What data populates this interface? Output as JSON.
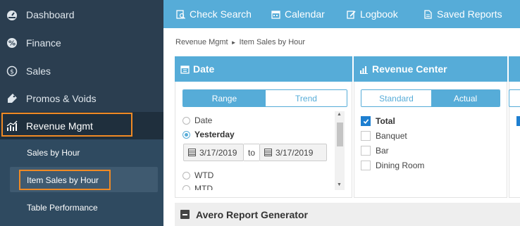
{
  "sidebar": {
    "items": [
      {
        "label": "Dashboard",
        "icon": "dashboard-icon"
      },
      {
        "label": "Finance",
        "icon": "percent-icon"
      },
      {
        "label": "Sales",
        "icon": "dollar-icon"
      },
      {
        "label": "Promos & Voids",
        "icon": "tag-icon"
      },
      {
        "label": "Revenue Mgmt",
        "icon": "chart-icon"
      }
    ],
    "subitems": [
      "Sales by Hour",
      "Item Sales by Hour",
      "Table Performance"
    ]
  },
  "toolbar": {
    "links": [
      "Check Search",
      "Calendar",
      "Logbook",
      "Saved Reports"
    ]
  },
  "breadcrumb": {
    "parent": "Revenue Mgmt",
    "separator": "►",
    "current": "Item Sales by Hour"
  },
  "date_card": {
    "title": "Date",
    "toggle": {
      "left": "Range",
      "right": "Trend"
    },
    "options": [
      "Date",
      "Yesterday",
      "WTD",
      "MTD"
    ],
    "selected_option": "Yesterday",
    "from": "3/17/2019",
    "to_label": "to",
    "to": "3/17/2019"
  },
  "revenue_card": {
    "title": "Revenue Center",
    "toggle": {
      "left": "Standard",
      "right": "Actual"
    },
    "centers": [
      {
        "label": "Total",
        "checked": true
      },
      {
        "label": "Banquet",
        "checked": false
      },
      {
        "label": "Bar",
        "checked": false
      },
      {
        "label": "Dining Room",
        "checked": false
      }
    ]
  },
  "report_generator": {
    "title": "Avero Report Generator"
  },
  "colors": {
    "sidebar": "#2b3e50",
    "accent": "#56acd8",
    "highlight": "#f08a24",
    "checkbox": "#1e7fd0"
  }
}
